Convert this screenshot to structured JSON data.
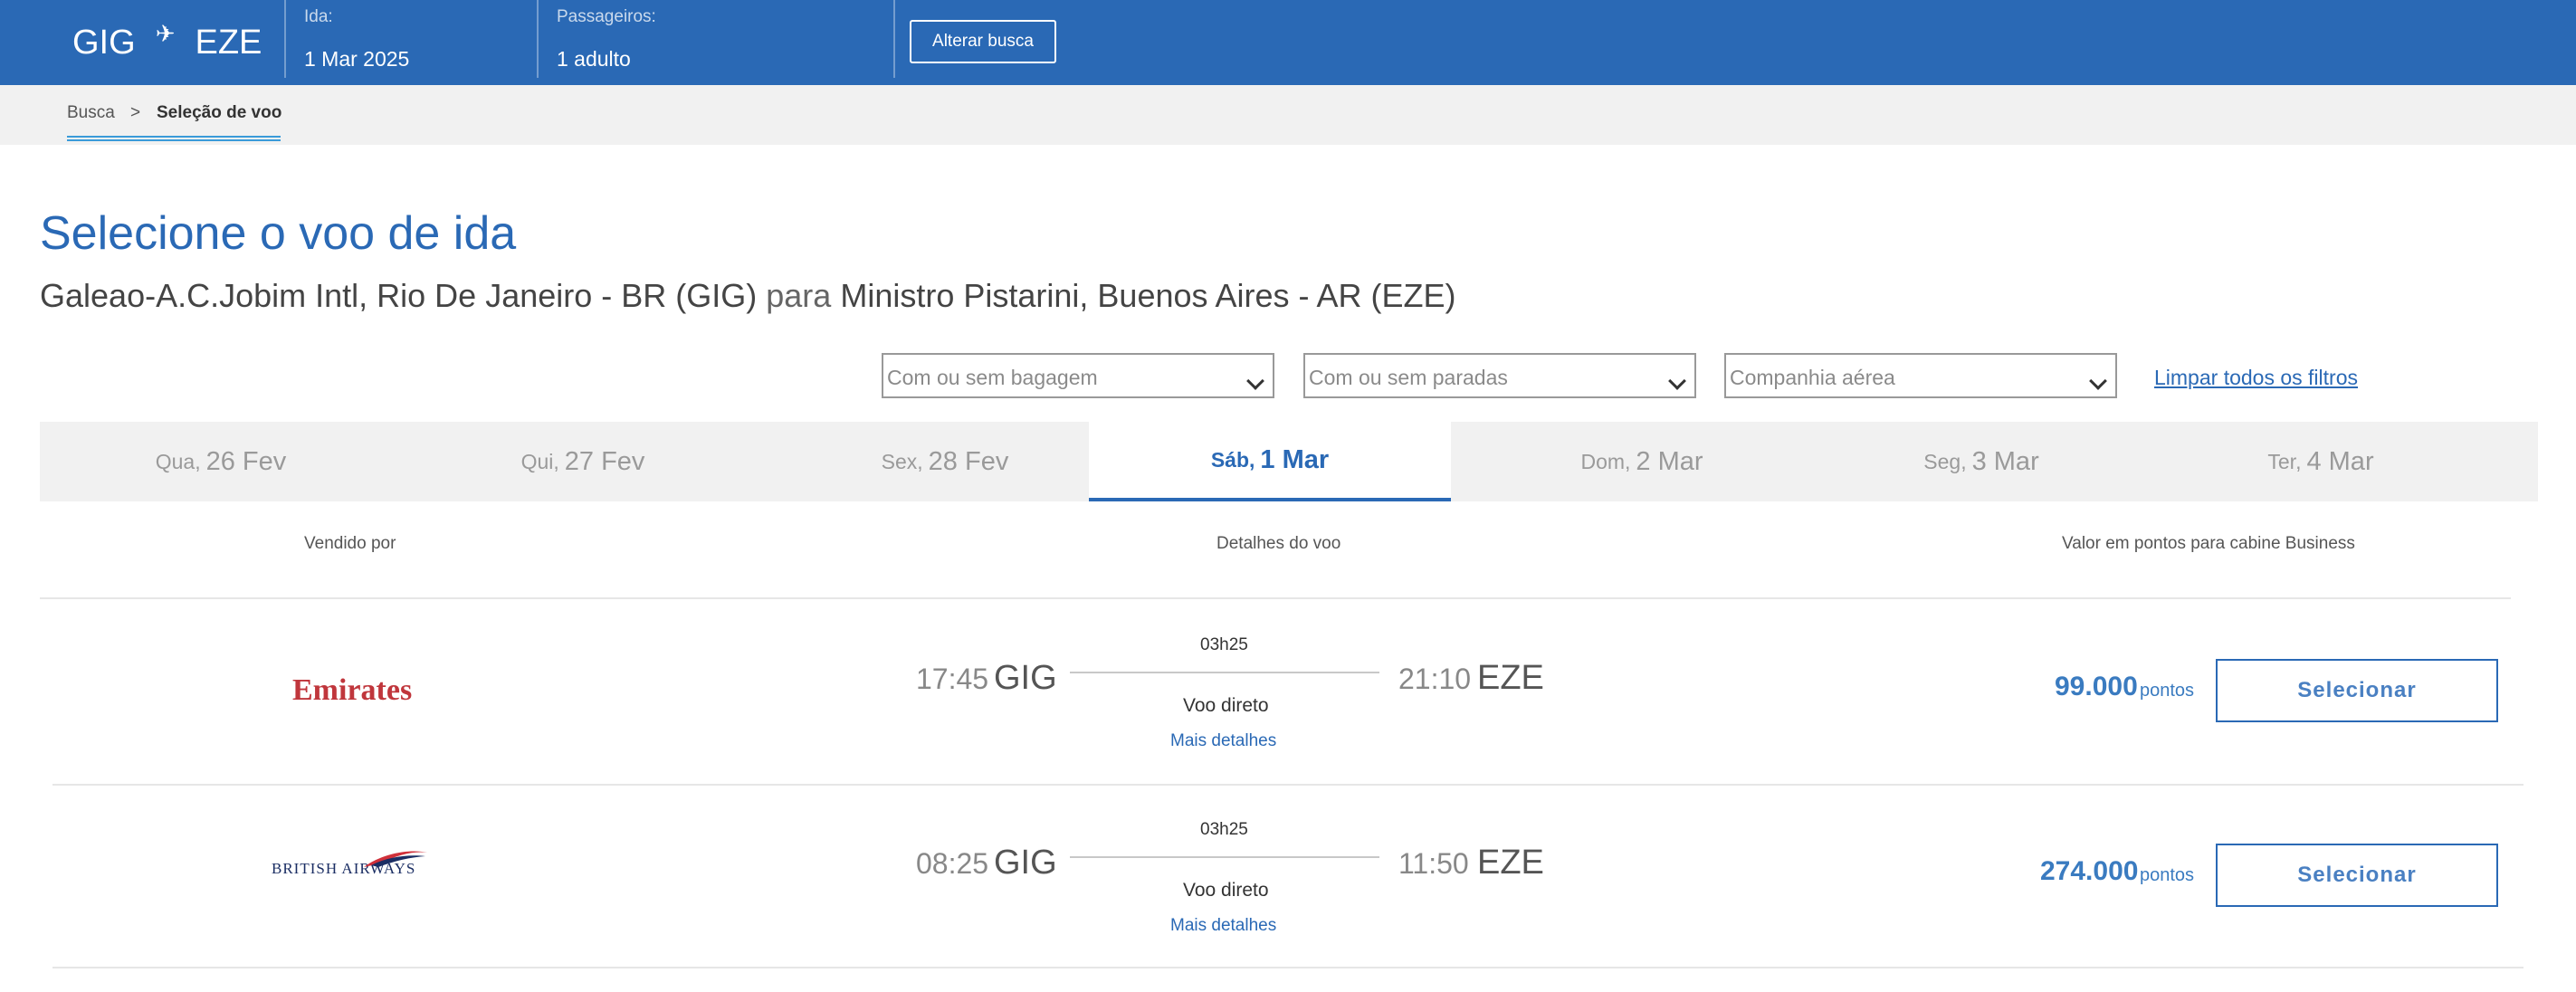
{
  "header": {
    "origin": "GIG",
    "destination": "EZE",
    "plane_icon": "airplane-icon",
    "departure_label": "Ida:",
    "departure_value": "1 Mar 2025",
    "passengers_label": "Passageiros:",
    "passengers_value": "1 adulto",
    "alter_button": "Alterar busca"
  },
  "breadcrumb": {
    "items": [
      "Busca",
      "Seleção de voo"
    ],
    "separator": ">"
  },
  "page": {
    "title": "Selecione o voo de ida",
    "origin_full": "Galeao-A.C.Jobim Intl, Rio De Janeiro - BR (GIG)",
    "connector": "para",
    "destination_full": "Ministro Pistarini, Buenos Aires - AR (EZE)"
  },
  "filters": {
    "baggage_placeholder": "Com ou sem bagagem",
    "stops_placeholder": "Com ou sem paradas",
    "airline_placeholder": "Companhia aérea",
    "clear_all": "Limpar todos os filtros"
  },
  "dates": [
    {
      "dow": "Qua,",
      "dm": "26 Fev"
    },
    {
      "dow": "Qui,",
      "dm": "27 Fev"
    },
    {
      "dow": "Sex,",
      "dm": "28 Fev"
    },
    {
      "dow": "Sáb,",
      "dm": "1 Mar",
      "active": true
    },
    {
      "dow": "Dom,",
      "dm": "2 Mar"
    },
    {
      "dow": "Seg,",
      "dm": "3 Mar"
    },
    {
      "dow": "Ter,",
      "dm": "4 Mar"
    }
  ],
  "columns": {
    "sold_by": "Vendido por",
    "details": "Detalhes do voo",
    "points": "Valor em pontos para cabine Business"
  },
  "flights": [
    {
      "airline": "Emirates",
      "depart_time": "17:45",
      "depart_code": "GIG",
      "duration": "03h25",
      "arrive_time": "21:10",
      "arrive_code": "EZE",
      "stops": "Voo direto",
      "more": "Mais detalhes",
      "points": "99.000",
      "points_unit": "pontos",
      "select": "Selecionar"
    },
    {
      "airline": "BRITISH AIRWAYS",
      "depart_time": "08:25",
      "depart_code": "GIG",
      "duration": "03h25",
      "arrive_time": "11:50",
      "arrive_code": "EZE",
      "stops": "Voo direto",
      "more": "Mais detalhes",
      "points": "274.000",
      "points_unit": "pontos",
      "select": "Selecionar"
    }
  ],
  "colors": {
    "brand_blue": "#2a69b5",
    "emirates_red": "#c0363c",
    "ba_navy": "#1a2d63"
  }
}
